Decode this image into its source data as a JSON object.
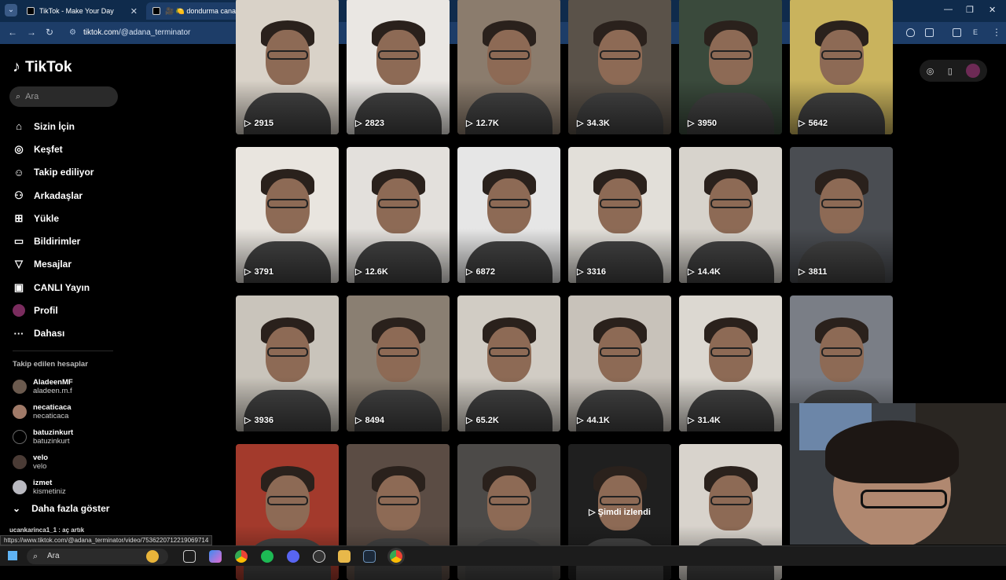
{
  "browser": {
    "tabs": [
      {
        "title": "TikTok - Make Your Day",
        "active": false
      },
      {
        "title": "🎥 🍋 dondurma canavarı 🍋 🔊",
        "active": true
      }
    ],
    "url_prefix": "tiktok.com",
    "url_path": "/@adana_terminator",
    "status_url": "https://www.tiktok.com/@adana_terminator/video/7536220712219069714"
  },
  "sidebar": {
    "brand": "TikTok",
    "search_placeholder": "Ara",
    "items": [
      {
        "label": "Sizin İçin",
        "icon": "home-icon"
      },
      {
        "label": "Keşfet",
        "icon": "compass-icon"
      },
      {
        "label": "Takip ediliyor",
        "icon": "following-icon"
      },
      {
        "label": "Arkadaşlar",
        "icon": "friends-icon"
      },
      {
        "label": "Yükle",
        "icon": "upload-icon"
      },
      {
        "label": "Bildirimler",
        "icon": "inbox-icon"
      },
      {
        "label": "Mesajlar",
        "icon": "send-icon"
      },
      {
        "label": "CANLI Yayın",
        "icon": "live-icon"
      },
      {
        "label": "Profil",
        "icon": "profile-avatar"
      },
      {
        "label": "Dahası",
        "icon": "more-icon"
      }
    ],
    "following_title": "Takip edilen hesaplar",
    "following": [
      {
        "name": "AladeenMF",
        "handle": "aladeen.m.f"
      },
      {
        "name": "necaticaca",
        "handle": "necaticaca"
      },
      {
        "name": "batuzinkurt",
        "handle": "batuzinkurt"
      },
      {
        "name": "velo",
        "handle": "velo"
      },
      {
        "name": "izmet",
        "handle": "kismetiniz"
      }
    ],
    "show_more": "Daha fazla göster",
    "cut_user": "ucankarinca1_1 : aç artık"
  },
  "videos": {
    "row1": [
      "2915",
      "2823",
      "12.7K",
      "34.3K",
      "3950",
      "5642"
    ],
    "row2": [
      "3791",
      "12.6K",
      "6872",
      "3316",
      "14.4K",
      "3811"
    ],
    "row3": [
      "3936",
      "8494",
      "65.2K",
      "44.1K",
      "31.4K",
      ""
    ],
    "row4_watched": "Şimdi izlendi"
  },
  "taskbar": {
    "search_placeholder": "Ara"
  },
  "colors": {
    "background": "#000000",
    "chrome": "#1d3d68",
    "tabbar": "#0f2b4c",
    "accent": "#fe2c55"
  }
}
